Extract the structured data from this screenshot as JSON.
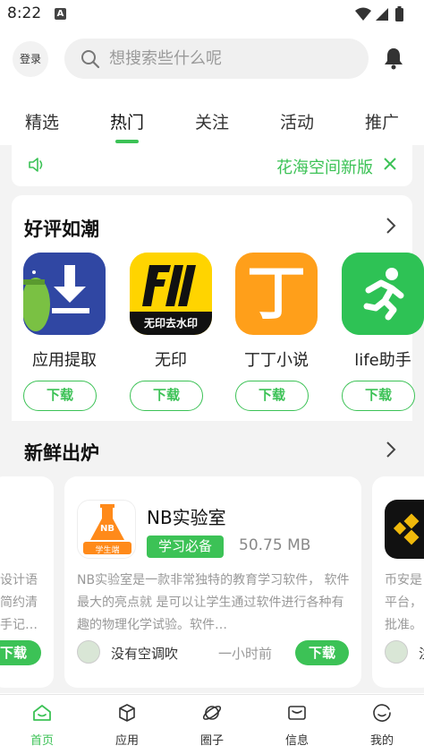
{
  "status_bar": {
    "time": "8:22",
    "notification_letter": "A"
  },
  "header": {
    "login_label": "登录",
    "search_placeholder": "想搜索些什么呢"
  },
  "tabs": [
    {
      "label": "精选"
    },
    {
      "label": "热门"
    },
    {
      "label": "关注"
    },
    {
      "label": "活动"
    },
    {
      "label": "推广"
    }
  ],
  "active_tab": "热门",
  "notice": {
    "text": "花海空间新版"
  },
  "section_popular": {
    "title": "好评如潮",
    "apps": [
      {
        "name": "应用提取",
        "button": "下载",
        "icon": "android-download-icon"
      },
      {
        "name": "无印",
        "button": "下载",
        "icon": "wuyin-logo",
        "icon_caption": "无印去水印"
      },
      {
        "name": "丁丁小说",
        "button": "下载",
        "icon": "ding-character-icon",
        "icon_glyph": "丁"
      },
      {
        "name": "life助手",
        "button": "下载",
        "icon": "running-man-icon"
      }
    ]
  },
  "section_fresh": {
    "title": "新鲜出炉",
    "left_partial": {
      "lines": [
        "设计语",
        "简约清",
        "手记…"
      ],
      "button": "下载"
    },
    "main": {
      "name": "NB实验室",
      "icon_badge": "NB",
      "icon_caption": "学生端",
      "tag": "学习必备",
      "size": "50.75 MB",
      "description": "NB实验室是一款非常独特的教育学习软件， 软件最大的亮点就 是可以让学生通过软件进行各种有趣的物理化学试验。软件…",
      "author": "没有空调吹",
      "time": "一小时前",
      "button": "下载"
    },
    "right_partial": {
      "lines": [
        "币安是",
        "平台，",
        "批准。"
      ],
      "author_initial": "注"
    }
  },
  "bottom_nav": [
    {
      "label": "首页",
      "icon": "home-icon"
    },
    {
      "label": "应用",
      "icon": "cube-icon"
    },
    {
      "label": "圈子",
      "icon": "planet-icon"
    },
    {
      "label": "信息",
      "icon": "mail-icon"
    },
    {
      "label": "我的",
      "icon": "smile-icon"
    }
  ],
  "colors": {
    "accent": "#3cc256",
    "background": "#f3f3f3"
  }
}
